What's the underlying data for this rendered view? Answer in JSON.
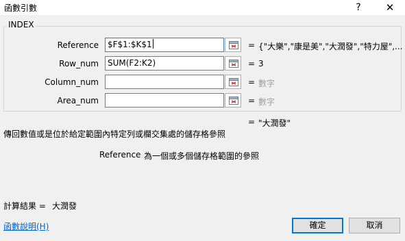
{
  "window": {
    "title": "函數引數",
    "help_glyph": "?",
    "close_glyph": "✕"
  },
  "function_name": "INDEX",
  "args": [
    {
      "label": "Reference",
      "value": "$F$1:$K$1",
      "equals": "=",
      "result": "{\"大樂\",\"康是美\",\"大潤發\",\"特力屋\",..."
    },
    {
      "label": "Row_num",
      "value": "SUM(F2:K2)",
      "equals": "=",
      "result": "3"
    },
    {
      "label": "Column_num",
      "value": "",
      "equals": "=",
      "result": "數字"
    },
    {
      "label": "Area_num",
      "value": "",
      "equals": "=",
      "result": "數字"
    }
  ],
  "overall": {
    "equals": "=",
    "result": "\"大潤發\""
  },
  "description": "傳回數值或是位於給定範圍內特定列或欄交集處的儲存格參照",
  "arg_help": {
    "name": "Reference",
    "text": "為一個或多個儲存格範圍的參照"
  },
  "calc": {
    "label": "計算結果 =",
    "value": "大潤發"
  },
  "help_link": "函數說明(H)",
  "buttons": {
    "ok": "確定",
    "cancel": "取消"
  },
  "colors": {
    "link": "#0066cc",
    "default_button_border": "#0078d7",
    "dialog_bg": "#f0f0f0"
  }
}
